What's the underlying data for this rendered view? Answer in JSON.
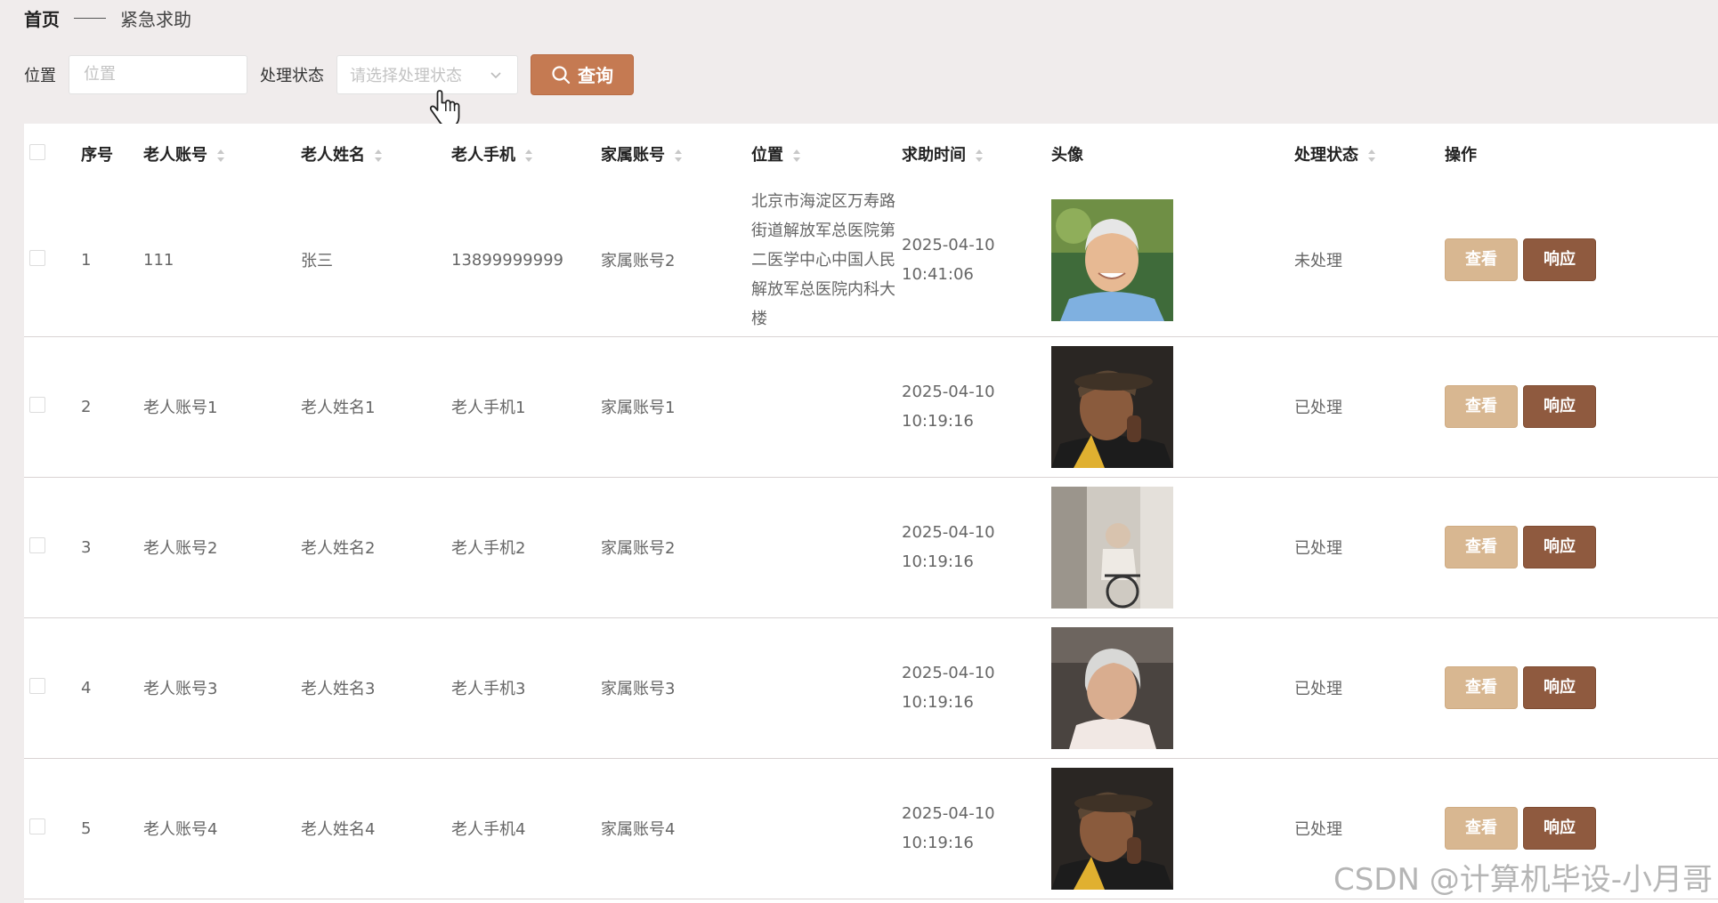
{
  "breadcrumb": {
    "home": "首页",
    "current": "紧急求助"
  },
  "filters": {
    "location_label": "位置",
    "location_placeholder": "位置",
    "status_label": "处理状态",
    "status_placeholder": "请选择处理状态",
    "search_label": "查询"
  },
  "table": {
    "columns": {
      "index": "序号",
      "elder_account": "老人账号",
      "elder_name": "老人姓名",
      "elder_phone": "老人手机",
      "family_account": "家属账号",
      "location": "位置",
      "help_time": "求助时间",
      "avatar": "头像",
      "status": "处理状态",
      "actions": "操作"
    },
    "view_label": "查看",
    "respond_label": "响应",
    "rows": [
      {
        "index": "1",
        "elder_account": "111",
        "elder_name": "张三",
        "elder_phone": "13899999999",
        "family_account": "家属账号2",
        "location": "北京市海淀区万寿路街道解放军总医院第二医学中心中国人民解放军总医院内科大楼",
        "help_time": "2025-04-10 10:41:06",
        "status": "未处理"
      },
      {
        "index": "2",
        "elder_account": "老人账号1",
        "elder_name": "老人姓名1",
        "elder_phone": "老人手机1",
        "family_account": "家属账号1",
        "location": "",
        "help_time": "2025-04-10 10:19:16",
        "status": "已处理"
      },
      {
        "index": "3",
        "elder_account": "老人账号2",
        "elder_name": "老人姓名2",
        "elder_phone": "老人手机2",
        "family_account": "家属账号2",
        "location": "",
        "help_time": "2025-04-10 10:19:16",
        "status": "已处理"
      },
      {
        "index": "4",
        "elder_account": "老人账号3",
        "elder_name": "老人姓名3",
        "elder_phone": "老人手机3",
        "family_account": "家属账号3",
        "location": "",
        "help_time": "2025-04-10 10:19:16",
        "status": "已处理"
      },
      {
        "index": "5",
        "elder_account": "老人账号4",
        "elder_name": "老人姓名4",
        "elder_phone": "老人手机4",
        "family_account": "家属账号4",
        "location": "",
        "help_time": "2025-04-10 10:19:16",
        "status": "已处理"
      }
    ]
  },
  "watermark": "CSDN @计算机毕设-小月哥",
  "colors": {
    "accent": "#c57a52",
    "view_button": "#d8b791",
    "respond_button": "#8f5a3f",
    "background": "#f0ecec"
  }
}
